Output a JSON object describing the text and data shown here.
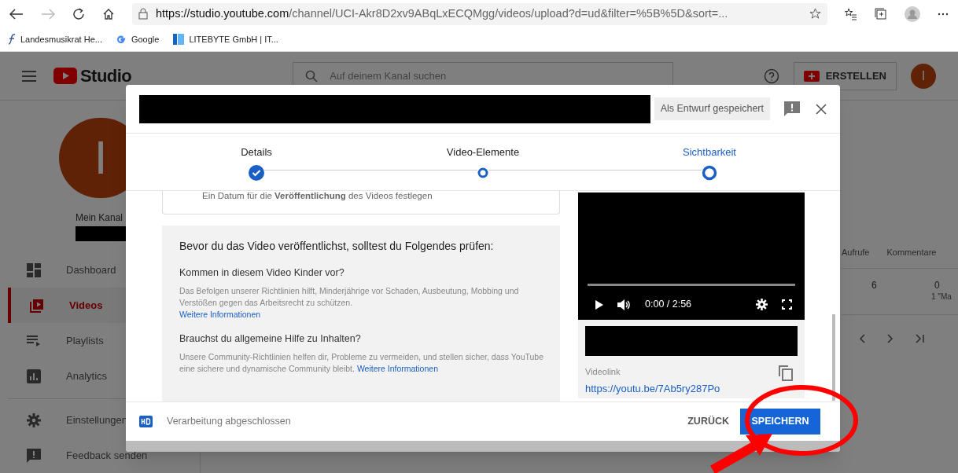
{
  "browser": {
    "url_host": "https://studio.youtube.com",
    "url_path": "/channel/UCI-Akr8D2xv9ABqLxECQMgg/videos/upload?d=ud&filter=%5B%5D&sort=...",
    "bookmarks": [
      {
        "label": "Landesmusikrat He...",
        "kind": "script"
      },
      {
        "label": "Google",
        "kind": "g"
      },
      {
        "label": "LITEBYTE GmbH | IT...",
        "kind": "bars"
      }
    ]
  },
  "studio": {
    "logo": "Studio",
    "search": {
      "placeholder": "Auf deinem Kanal suchen"
    },
    "create": "ERSTELLEN",
    "avatar": "I"
  },
  "sidebar": {
    "avatar": "I",
    "channel_label": "Mein Kanal",
    "items": [
      {
        "label": "Dashboard",
        "selected": false
      },
      {
        "label": "Videos",
        "selected": true
      },
      {
        "label": "Playlists",
        "selected": false
      },
      {
        "label": "Analytics",
        "selected": false
      },
      {
        "label": "Einstellungen",
        "selected": false
      },
      {
        "label": "Feedback senden",
        "selected": false
      }
    ]
  },
  "table": {
    "columns": [
      "Aufrufe",
      "Kommentare"
    ],
    "row": [
      "6",
      "0"
    ],
    "note": "1 \"Ma"
  },
  "dialog": {
    "draft_status": "Als Entwurf gespeichert",
    "steps": [
      {
        "label": "Details",
        "kind": "done",
        "selected": false
      },
      {
        "label": "Video-Elemente",
        "kind": "visited",
        "selected": false
      },
      {
        "label": "Sichtbarkeit",
        "kind": "current",
        "selected": true
      }
    ],
    "schedule_text": "Ein Datum für die **Veröffentlichung** des Videos festlegen",
    "checklist": {
      "title": "Bevor du das Video veröffentlichst, solltest du Folgendes prüfen:",
      "sections": [
        {
          "heading": "Kommen in diesem Video Kinder vor?",
          "body": "Das Befolgen unserer Richtlinien hilft, Minderjährige vor Schaden, Ausbeutung, Mobbing und Verstößen gegen das Arbeitsrecht zu schützen.",
          "link": "Weitere Informationen",
          "kind": "newline"
        },
        {
          "heading": "Brauchst du allgemeine Hilfe zu Inhalten?",
          "body": "Unsere Community-Richtlinien helfen dir, Probleme zu vermeiden, und stellen sicher, dass YouTube eine sichere und dynamische Community bleibt.",
          "link": "Weitere Informationen",
          "kind": "inline"
        }
      ]
    },
    "player": {
      "time": "0:00 / 2:56"
    },
    "video_link": {
      "label": "Videolink",
      "url": "https://youtu.be/7Ab5ry287Po"
    },
    "footer": {
      "status": "Verarbeitung abgeschlossen",
      "back": "ZURÜCK",
      "save": "SPEICHERN"
    }
  }
}
